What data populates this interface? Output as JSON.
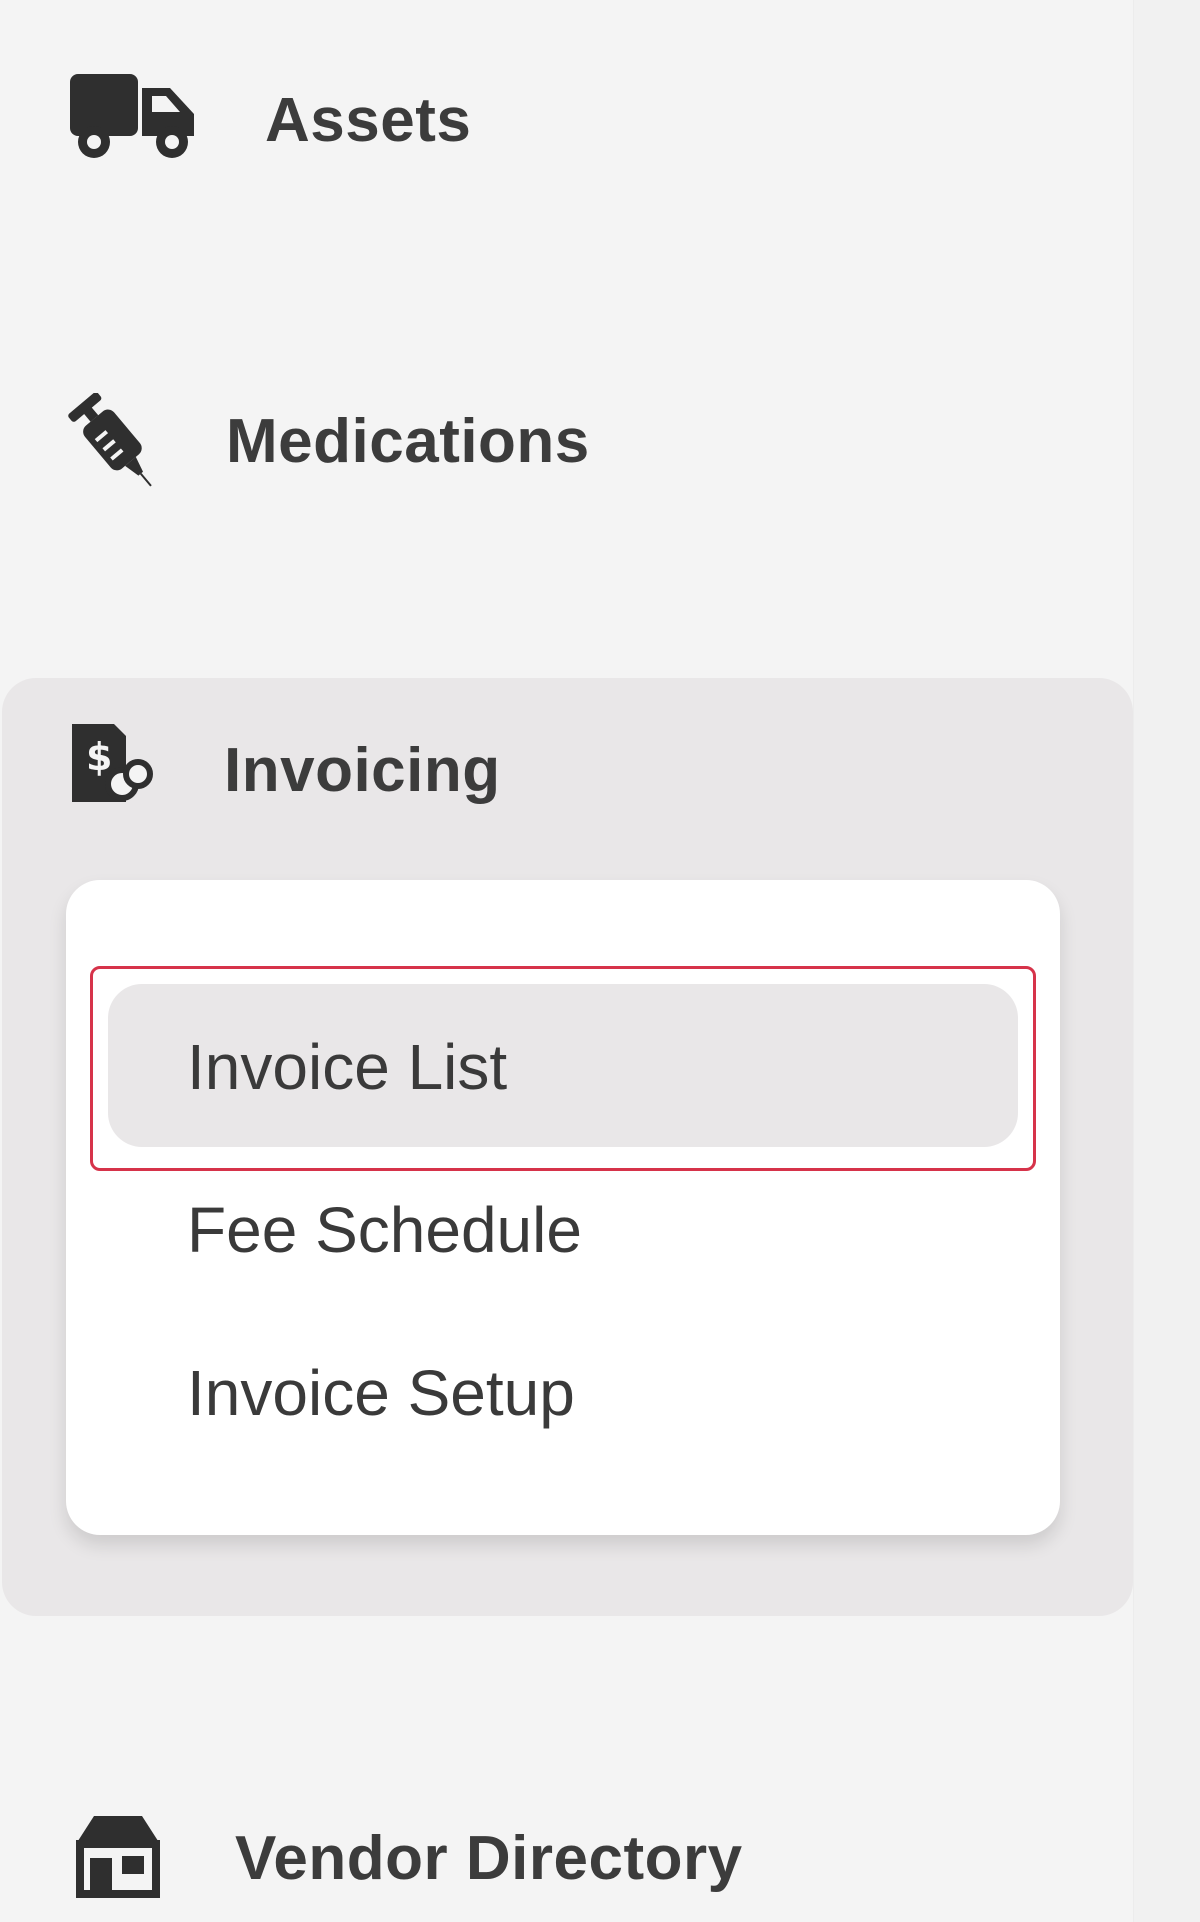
{
  "nav": {
    "assets": {
      "label": "Assets",
      "icon": "truck-icon"
    },
    "medications": {
      "label": "Medications",
      "icon": "syringe-icon"
    },
    "invoicing": {
      "label": "Invoicing",
      "icon": "invoice-dollar-icon",
      "expanded": true,
      "submenu": [
        {
          "label": "Invoice List",
          "active": true
        },
        {
          "label": "Fee Schedule",
          "active": false
        },
        {
          "label": "Invoice Setup",
          "active": false
        }
      ]
    },
    "vendor_directory": {
      "label": "Vendor Directory",
      "icon": "store-icon"
    }
  },
  "colors": {
    "background": "#f4f4f4",
    "group_background": "#e9e7e8",
    "submenu_background": "#ffffff",
    "active_pill": "#e9e7e8",
    "highlight_border": "#d6334a",
    "text": "#3c3c3c"
  }
}
